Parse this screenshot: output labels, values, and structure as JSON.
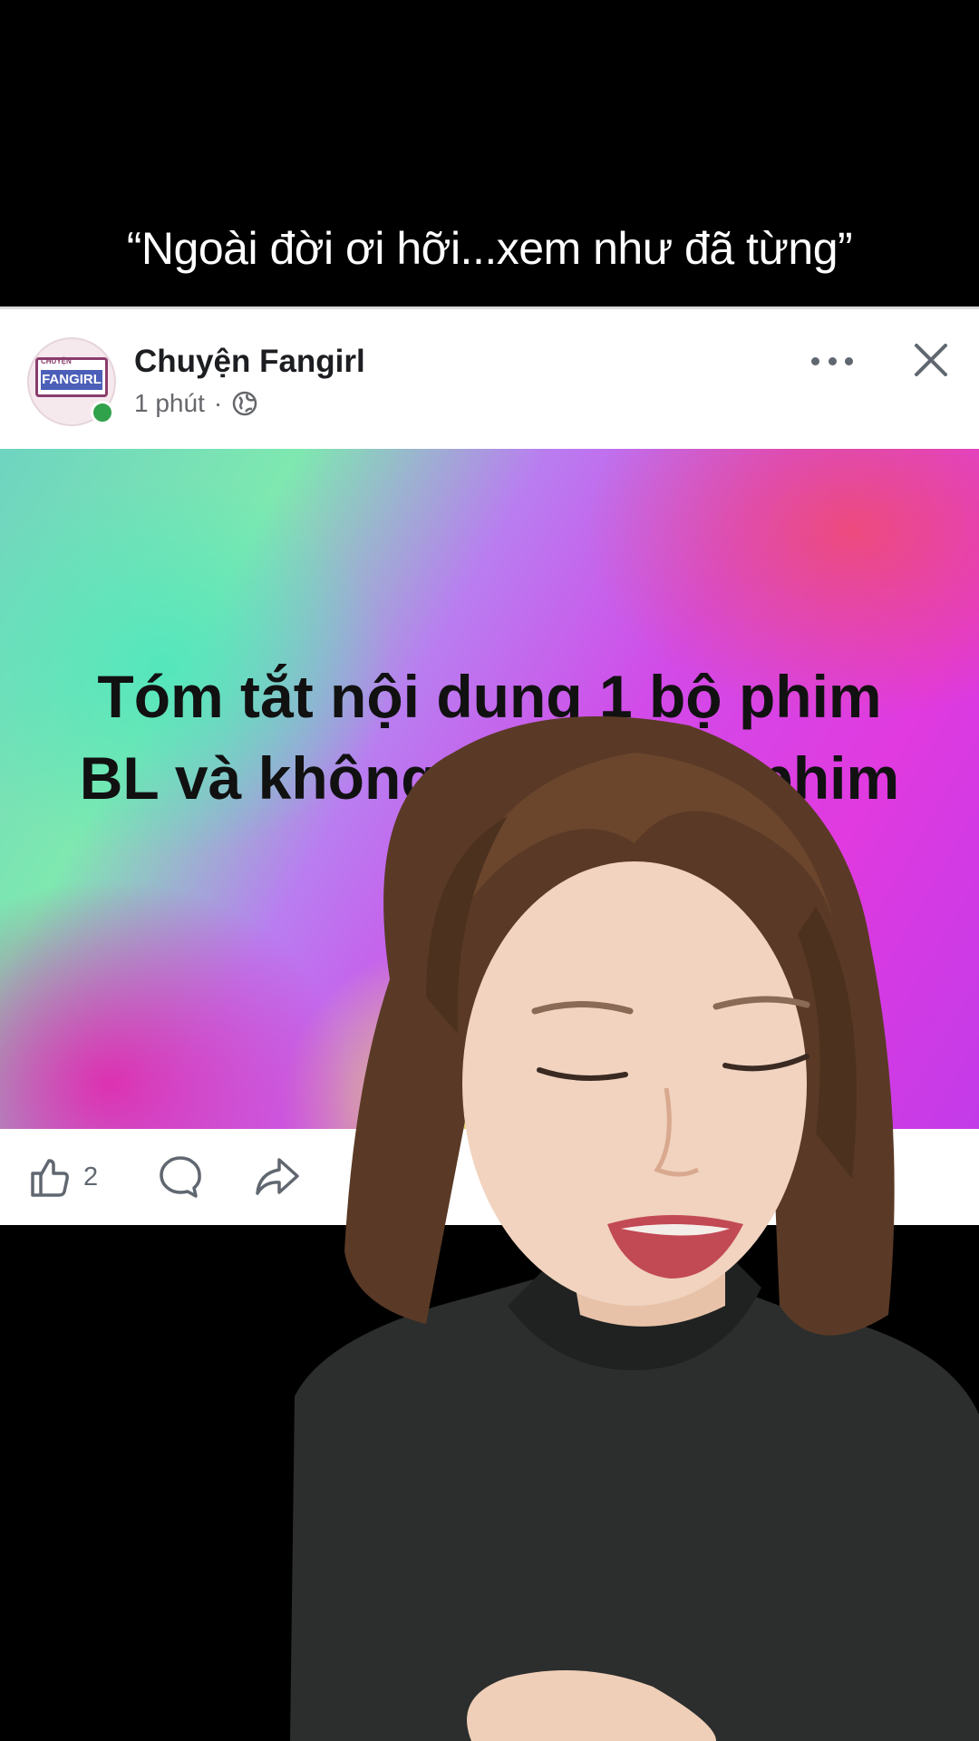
{
  "video": {
    "caption": "“Ngoài đời ơi hỡi...xem như đã từng”"
  },
  "post": {
    "author": "Chuyện Fangirl",
    "time": "1 phút",
    "separator": "·",
    "avatar_small_text": "CHUYỆN",
    "avatar_big_text": "FANGIRL",
    "image_title": "Tóm tắt nội dung 1 bộ phim BL và không nói tên bộ phim",
    "like_count": "2",
    "icons": {
      "privacy": "globe-icon",
      "more": "more-options-icon",
      "close": "close-icon",
      "like": "like-icon",
      "comment": "comment-icon",
      "share": "share-icon"
    },
    "colors": {
      "online": "#31a24c",
      "text_primary": "#1c1e21",
      "text_secondary": "#65676b"
    }
  }
}
